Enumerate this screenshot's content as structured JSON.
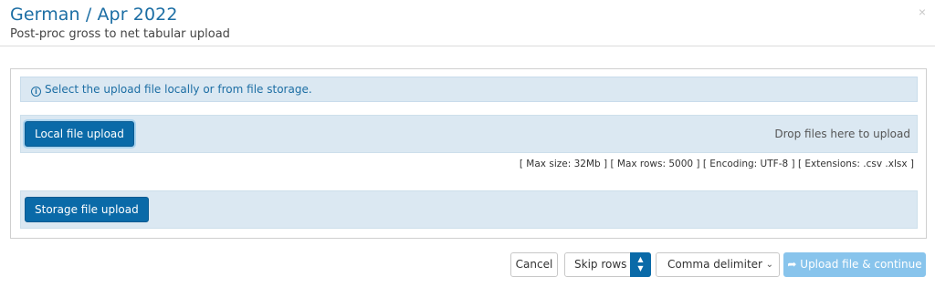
{
  "header": {
    "title": "German / Apr 2022",
    "subtitle": "Post-proc gross to net tabular upload",
    "close_icon": "×"
  },
  "info": {
    "icon": "i",
    "text": "Select the upload file locally or from file storage."
  },
  "local": {
    "button_label": "Local file upload",
    "drop_text": "Drop files here to upload"
  },
  "limits_text": "[ Max size: 32Mb ] [ Max rows: 5000 ] [ Encoding: UTF-8 ] [ Extensions: .csv .xlsx ]",
  "storage": {
    "button_label": "Storage file upload"
  },
  "footer": {
    "cancel_label": "Cancel",
    "skip_rows_label": "Skip rows",
    "delimiter_selected": "Comma delimiter",
    "upload_label": "Upload file & continue",
    "upload_icon": "➦"
  },
  "colors": {
    "accent": "#1c6ea4",
    "primary_button": "#0a6aa8",
    "disabled_button": "#88c4ec",
    "panel_bg": "#dbe8f2"
  }
}
